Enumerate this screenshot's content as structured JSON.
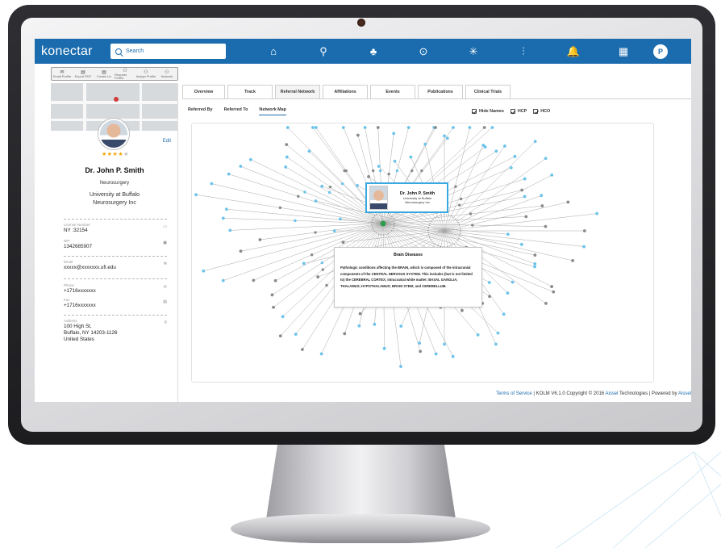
{
  "app": {
    "logo": "konectar",
    "logo_mark": "™"
  },
  "search": {
    "label": "Search"
  },
  "nav": {
    "icons": [
      "home-icon",
      "search-person-icon",
      "user-network-icon",
      "globe-icon",
      "asterisk-icon",
      "chart-icon",
      "bell-icon",
      "grid-icon"
    ],
    "glyphs": [
      "⌂",
      "⚲",
      "♣",
      "⊙",
      "✳",
      "⫶",
      "🔔",
      "▦"
    ],
    "profile_initial": "P"
  },
  "toolbar": {
    "buttons": [
      {
        "icon": "mail-icon",
        "glyph": "✉",
        "label": "Email Profile"
      },
      {
        "icon": "pdf-icon",
        "glyph": "▤",
        "label": "Export PDF"
      },
      {
        "icon": "doc-icon",
        "glyph": "▤",
        "label": "Create Lic"
      },
      {
        "icon": "request-icon",
        "glyph": "⚇",
        "label": "Request Profile"
      },
      {
        "icon": "assign-icon",
        "glyph": "⚇",
        "label": "Assign Profile"
      },
      {
        "icon": "network-icon",
        "glyph": "⚇",
        "label": "Network"
      }
    ]
  },
  "profile": {
    "edit_label": "Edit",
    "rating": "★★★★",
    "rating_empty": "★",
    "name": "Dr. John P. Smith",
    "specialty": "Neurosurgery",
    "org_line1": "University at Buffalo",
    "org_line2": "Neurosurgery Inc",
    "license_label": "License Number",
    "license_value": "NY :32154",
    "npi_label": "NPI",
    "npi_value": "1342685907",
    "email_label": "Email",
    "email_value": "xxxxx@xxxxxxx.ufl.edu",
    "phone_label": "Phone",
    "phone_value": "+1716xxxxxxx",
    "fax_label": "Fax",
    "fax_value": "+1716xxxxxxx",
    "address_label": "Address",
    "address_line1": "100 High St,",
    "address_line2": "Buffalo, NY 14203-1126",
    "address_line3": "United States"
  },
  "tabs": [
    "Overview",
    "Track",
    "Referral Network",
    "Affiliations",
    "Events",
    "Publications",
    "Clinical Trials"
  ],
  "active_tab": "Referral Network",
  "subtabs": [
    "Referred By",
    "Referred To",
    "Network Map"
  ],
  "active_subtab": "Network Map",
  "filters": [
    {
      "label": "Hide Names",
      "checked": true
    },
    {
      "label": "HCP",
      "checked": true
    },
    {
      "label": "HCO",
      "checked": true
    }
  ],
  "network": {
    "center_name": "Dr. John P. Smith",
    "center_org1": "University at Buffalo",
    "center_org2": "Neurosurgery Inc",
    "tooltip_title": "Brain Diseases",
    "tooltip_text": "Pathologic conditions affecting the BRAIN, which is composed of the intracranial components of the CENTRAL NERVOUS SYSTEM. This includes (but is not limited to) the CEREBRAL CORTEX; intracranial white matter; BASAL GANGLIA; THALAMUS; HYPOTHALAMUS; BRAIN STEM; and CEREBELLUM.",
    "colors": {
      "hcp": "#6cc3ea",
      "hco": "#8a8a8a",
      "center": "#2e9b4e",
      "edge": "#a8a8a8"
    }
  },
  "footer": {
    "terms": "Terms of Service",
    "text1": " | KOLM V6.1.0 Copyright © 2016 ",
    "aissel": "Aissel",
    "text2": " Technologies | Powered by ",
    "aissel2": "Aissel"
  }
}
